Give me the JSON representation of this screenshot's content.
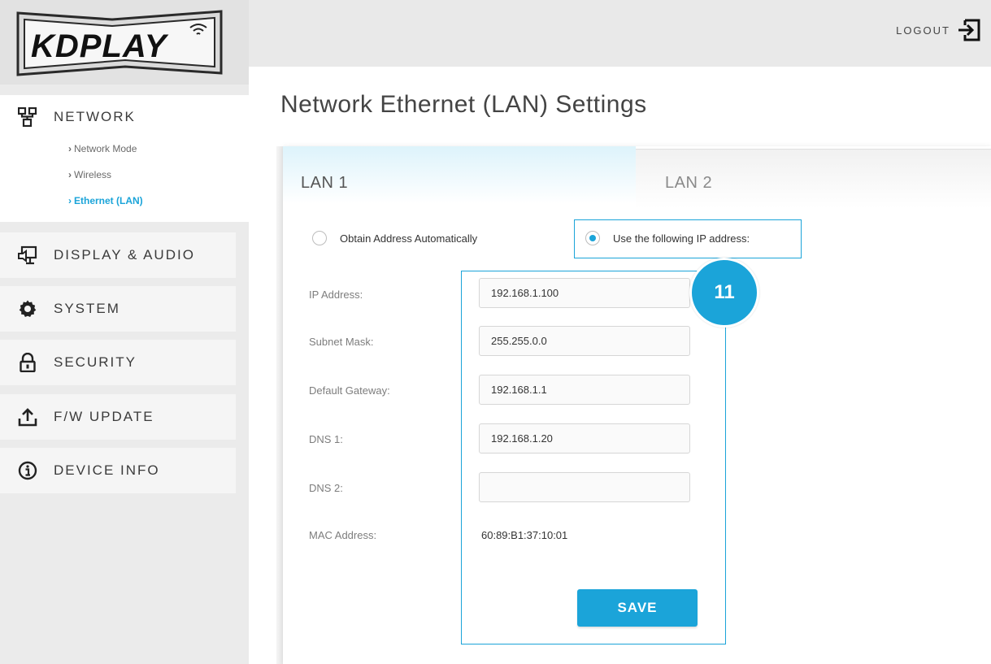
{
  "brand": {
    "logo_text": "KDPLAY",
    "accent": "#1ba4d9"
  },
  "header": {
    "logout_label": "LOGOUT"
  },
  "sidebar": {
    "network": {
      "label": "NETWORK",
      "icon": "network-icon",
      "subitems": [
        {
          "label": "Network Mode",
          "active": false
        },
        {
          "label": "Wireless",
          "active": false
        },
        {
          "label": "Ethernet (LAN)",
          "active": true
        }
      ]
    },
    "items": [
      {
        "label": "DISPLAY & AUDIO",
        "icon": "display-audio-icon"
      },
      {
        "label": "SYSTEM",
        "icon": "gear-icon"
      },
      {
        "label": "SECURITY",
        "icon": "lock-icon"
      },
      {
        "label": "F/W UPDATE",
        "icon": "upload-icon"
      },
      {
        "label": "DEVICE INFO",
        "icon": "info-icon"
      }
    ]
  },
  "main": {
    "title": "Network Ethernet (LAN) Settings",
    "tabs": [
      {
        "label": "LAN 1",
        "active": true
      },
      {
        "label": "LAN 2",
        "active": false
      }
    ],
    "mode_options": [
      {
        "label": "Obtain Address Automatically",
        "selected": false
      },
      {
        "label": "Use the following IP address:",
        "selected": true
      }
    ],
    "fields": {
      "ip": {
        "label": "IP Address:",
        "value": "192.168.1.100"
      },
      "subnet": {
        "label": "Subnet Mask:",
        "value": "255.255.0.0"
      },
      "gateway": {
        "label": "Default Gateway:",
        "value": "192.168.1.1"
      },
      "dns1": {
        "label": "DNS 1:",
        "value": "192.168.1.20"
      },
      "dns2": {
        "label": "DNS 2:",
        "value": ""
      },
      "mac": {
        "label": "MAC Address:",
        "value": "60:89:B1:37:10:01"
      }
    },
    "save_label": "SAVE",
    "callout_number": "11"
  }
}
